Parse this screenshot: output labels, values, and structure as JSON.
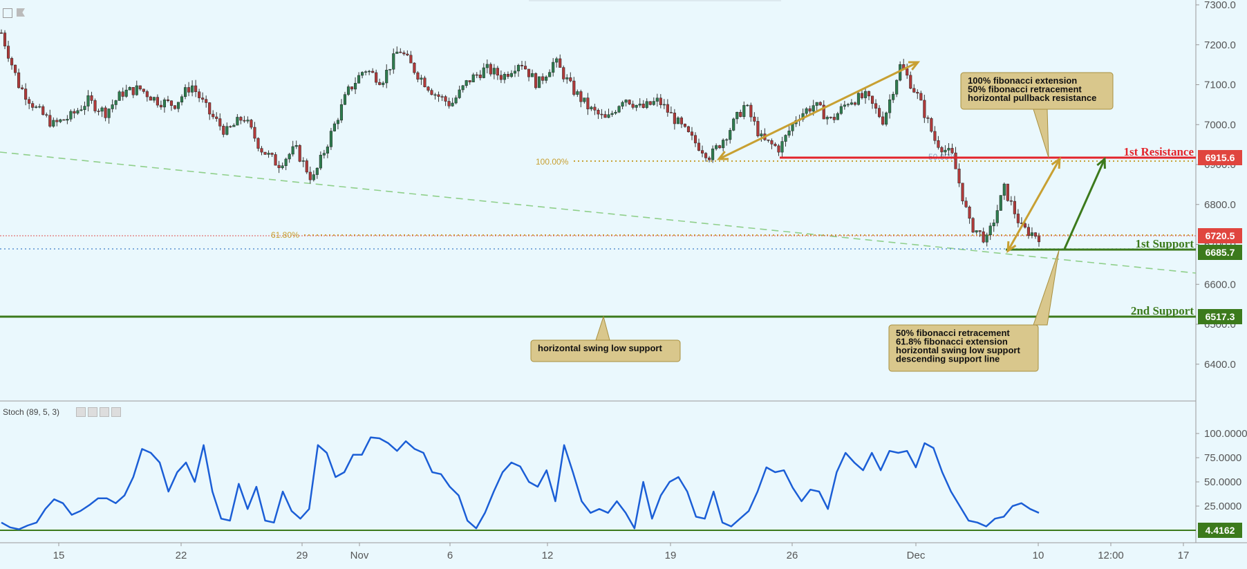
{
  "colors": {
    "background": "#eaf8fd",
    "up_candle": "#2e7d4f",
    "down_candle": "#b03a3a",
    "fib": "#c8a032",
    "resistance": "#e3242b",
    "support": "#3c7a1c",
    "stoch": "#1b5ed6",
    "dashed_trend": "#8fcf8a",
    "callout_fill": "#d9c78c",
    "callout_border": "#a88f3e",
    "tag_green": "#3c7a1c",
    "tag_red": "#e0453e"
  },
  "chart_data": [
    {
      "type": "candlestick",
      "price_axis": {
        "ticks": [
          "7300.0",
          "7200.0",
          "7100.0",
          "7000.0",
          "6900.0",
          "6800.0",
          "6700.0",
          "6600.0",
          "6500.0",
          "6400.0"
        ],
        "ylim": [
          6310,
          7310
        ]
      },
      "time_axis": [
        "15",
        "22",
        "29",
        "Nov",
        "6",
        "12",
        "19",
        "26",
        "Dec",
        "10",
        "12:00",
        "17"
      ],
      "close_path": [
        [
          "Oct 11",
          7230
        ],
        [
          "Oct 12",
          7100
        ],
        [
          "Oct 13",
          7040
        ],
        [
          "Oct 14",
          7000
        ],
        [
          "Oct 15",
          7020
        ],
        [
          "Oct 16",
          7060
        ],
        [
          "Oct 17",
          7030
        ],
        [
          "Oct 18",
          7080
        ],
        [
          "Oct 19",
          7090
        ],
        [
          "Oct 20",
          7060
        ],
        [
          "Oct 21",
          7050
        ],
        [
          "Oct 22",
          7100
        ],
        [
          "Oct 23",
          7030
        ],
        [
          "Oct 24",
          6980
        ],
        [
          "Oct 25",
          7020
        ],
        [
          "Oct 26",
          6940
        ],
        [
          "Oct 27",
          6900
        ],
        [
          "Oct 28",
          6940
        ],
        [
          "Oct 29",
          6860
        ],
        [
          "Oct 30",
          6970
        ],
        [
          "Oct 31",
          7080
        ],
        [
          "Nov 1",
          7140
        ],
        [
          "Nov 2",
          7110
        ],
        [
          "Nov 3",
          7190
        ],
        [
          "Nov 4",
          7130
        ],
        [
          "Nov 5",
          7080
        ],
        [
          "Nov 6",
          7050
        ],
        [
          "Nov 7",
          7110
        ],
        [
          "Nov 8",
          7140
        ],
        [
          "Nov 9",
          7120
        ],
        [
          "Nov 10",
          7160
        ],
        [
          "Nov 11",
          7100
        ],
        [
          "Nov 12",
          7160
        ],
        [
          "Nov 13",
          7090
        ],
        [
          "Nov 14",
          7040
        ],
        [
          "Nov 15",
          7010
        ],
        [
          "Nov 16",
          7070
        ],
        [
          "Nov 17",
          7040
        ],
        [
          "Nov 18",
          7060
        ],
        [
          "Nov 19",
          7010
        ],
        [
          "Nov 20",
          6960
        ],
        [
          "Nov 21",
          6920
        ],
        [
          "Nov 22",
          6980
        ],
        [
          "Nov 23",
          7050
        ],
        [
          "Nov 24",
          6960
        ],
        [
          "Nov 25",
          6940
        ],
        [
          "Nov 26",
          7020
        ],
        [
          "Nov 27",
          7050
        ],
        [
          "Nov 28",
          7010
        ],
        [
          "Nov 29",
          7060
        ],
        [
          "Nov 30",
          7070
        ],
        [
          "Dec 1",
          7010
        ],
        [
          "Dec 2",
          7150
        ],
        [
          "Dec 3",
          7070
        ],
        [
          "Dec 4",
          6960
        ],
        [
          "Dec 5",
          6920
        ],
        [
          "Dec 6",
          6750
        ],
        [
          "Dec 7",
          6710
        ],
        [
          "Dec 8",
          6840
        ],
        [
          "Dec 9",
          6740
        ],
        [
          "Dec 10",
          6720
        ]
      ],
      "levels": [
        {
          "name": "1st Resistance",
          "value": 6915.6,
          "tag": "6915.6"
        },
        {
          "name": "1st Support",
          "value": 6685.7,
          "tag": "6685.7"
        },
        {
          "name": "2nd Support",
          "value": 6517.3,
          "tag": "6517.3"
        },
        {
          "name": "",
          "value": 6720.5,
          "tag": "6720.5"
        }
      ],
      "fib_labels": [
        "100.00%",
        "61.80%",
        "50.00%"
      ],
      "annotations": [
        "100% fibonacci extension\n50% fibonacci retracement\nhorizontal pullback resistance",
        "horizontal swing low support",
        "50% fibonacci retracement\n61.8% fibonacci extension\nhorizontal swing low support\ndescending support line"
      ]
    },
    {
      "type": "line",
      "indicator": "Stoch (89, 5, 3)",
      "y_axis": {
        "ticks": [
          "100.0000",
          "75.0000",
          "50.0000",
          "25.0000"
        ],
        "ylim": [
          0,
          103
        ]
      },
      "level": {
        "value": 4.4162,
        "tag": "4.4162"
      },
      "values": [
        8,
        3,
        1,
        5,
        8,
        22,
        32,
        28,
        16,
        20,
        26,
        33,
        33,
        28,
        36,
        55,
        84,
        80,
        70,
        40,
        60,
        70,
        50,
        88,
        40,
        12,
        10,
        48,
        22,
        45,
        10,
        8,
        40,
        20,
        12,
        22,
        88,
        80,
        55,
        60,
        78,
        78,
        96,
        95,
        90,
        82,
        92,
        84,
        80,
        60,
        58,
        45,
        36,
        10,
        2,
        18,
        40,
        60,
        70,
        66,
        50,
        45,
        62,
        30,
        88,
        60,
        30,
        18,
        22,
        18,
        30,
        18,
        2,
        50,
        12,
        36,
        50,
        55,
        40,
        14,
        12,
        40,
        8,
        4,
        12,
        20,
        40,
        65,
        60,
        62,
        44,
        30,
        42,
        40,
        22,
        60,
        80,
        70,
        62,
        80,
        62,
        82,
        80,
        82,
        65,
        90,
        85,
        60,
        40,
        25,
        10,
        8,
        4,
        12,
        14,
        25,
        28,
        22,
        18
      ]
    }
  ]
}
